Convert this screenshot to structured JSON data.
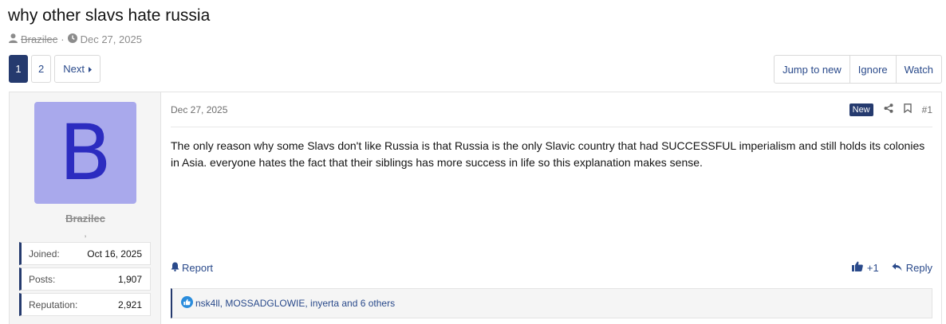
{
  "thread": {
    "title": "why other slavs hate russia",
    "author": "Brazilec",
    "separator": "·",
    "date": "Dec 27, 2025"
  },
  "pagination": {
    "pages": [
      "1",
      "2"
    ],
    "current": "1",
    "next_label": "Next"
  },
  "thread_actions": {
    "jump_to_new": "Jump to new",
    "ignore": "Ignore",
    "watch": "Watch"
  },
  "post": {
    "date": "Dec 27, 2025",
    "new_badge": "New",
    "number": "#1",
    "body": "The only reason why some Slavs don't like Russia is that Russia is the only Slavic country that had SUCCESSFUL imperialism and still holds its colonies in Asia. everyone hates the fact that their siblings has more success in life so this explanation makes sense.",
    "report_label": "Report",
    "react_label": "+1",
    "reply_label": "Reply",
    "reactions_text": "nsk4ll, MOSSADGLOWIE, inyerta and 6 others"
  },
  "user": {
    "avatar_letter": "B",
    "avatar_bg": "#a9a9ec",
    "avatar_fg": "#2c2cc0",
    "username": "Brazilec",
    "title": ",",
    "stats": [
      {
        "label": "Joined:",
        "value": "Oct 16, 2025"
      },
      {
        "label": "Posts:",
        "value": "1,907"
      },
      {
        "label": "Reputation:",
        "value": "2,921"
      }
    ]
  },
  "colors": {
    "accent": "#253a6e",
    "link": "#2a4a8b"
  }
}
